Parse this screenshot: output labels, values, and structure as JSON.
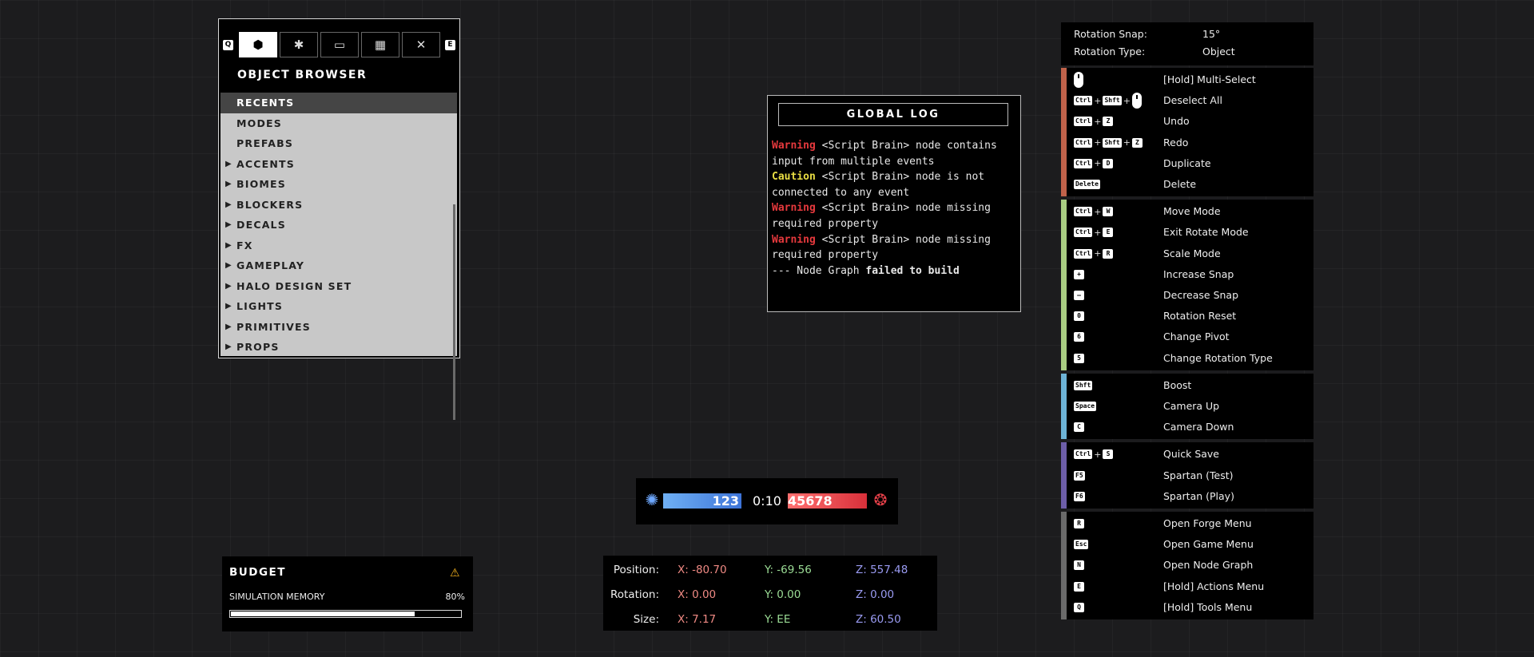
{
  "object_browser": {
    "key_left": "Q",
    "key_right": "E",
    "tabs": [
      "object-browser-icon",
      "settings-icon",
      "folder-icon",
      "map-icon",
      "tools-icon"
    ],
    "title": "OBJECT BROWSER",
    "items": [
      {
        "label": "RECENTS",
        "arrow": ""
      },
      {
        "label": "MODES",
        "arrow": ""
      },
      {
        "label": "PREFABS",
        "arrow": ""
      },
      {
        "label": "ACCENTS",
        "arrow": "▶"
      },
      {
        "label": "BIOMES",
        "arrow": "▶"
      },
      {
        "label": "BLOCKERS",
        "arrow": "▶"
      },
      {
        "label": "DECALS",
        "arrow": "▶"
      },
      {
        "label": "FX",
        "arrow": "▶"
      },
      {
        "label": "GAMEPLAY",
        "arrow": "▶"
      },
      {
        "label": "HALO DESIGN SET",
        "arrow": "▶"
      },
      {
        "label": "LIGHTS",
        "arrow": "▶"
      },
      {
        "label": "PRIMITIVES",
        "arrow": "▶"
      },
      {
        "label": "PROPS",
        "arrow": "▶"
      }
    ]
  },
  "global_log": {
    "title": "GLOBAL LOG",
    "entries": [
      {
        "level": "Warning",
        "text": "<Script Brain>  node contains input from multiple events"
      },
      {
        "level": "Caution",
        "text": "<Script Brain>  node is not connected to any event"
      },
      {
        "level": "Warning",
        "text": "<Script Brain>  node missing required property"
      },
      {
        "level": "Warning",
        "text": "<Script Brain>  node missing required property"
      }
    ],
    "footer_prefix": "--- Node Graph ",
    "footer_bold": "failed to build"
  },
  "controls": {
    "rotation_snap_label": "Rotation Snap:",
    "rotation_snap_value": "15°",
    "rotation_type_label": "Rotation Type:",
    "rotation_type_value": "Object",
    "groups": [
      {
        "color": "#c0624a",
        "rows": [
          {
            "keys": [
              "MOUSE"
            ],
            "label": "[Hold] Multi-Select"
          },
          {
            "keys": [
              "Ctrl",
              "+",
              "Shft",
              "+",
              "MOUSE"
            ],
            "label": "Deselect All"
          },
          {
            "keys": [
              "Ctrl",
              "+",
              "Z"
            ],
            "label": "Undo"
          },
          {
            "keys": [
              "Ctrl",
              "+",
              "Shft",
              "+",
              "Z"
            ],
            "label": "Redo"
          },
          {
            "keys": [
              "Ctrl",
              "+",
              "D"
            ],
            "label": "Duplicate"
          },
          {
            "keys": [
              "Delete"
            ],
            "label": "Delete"
          }
        ]
      },
      {
        "color": "#a9cd82",
        "rows": [
          {
            "keys": [
              "Ctrl",
              "+",
              "W"
            ],
            "label": "Move Mode"
          },
          {
            "keys": [
              "Ctrl",
              "+",
              "E"
            ],
            "label": "Exit Rotate Mode"
          },
          {
            "keys": [
              "Ctrl",
              "+",
              "R"
            ],
            "label": "Scale Mode"
          },
          {
            "keys": [
              "+"
            ],
            "label": "Increase Snap"
          },
          {
            "keys": [
              "–"
            ],
            "label": "Decrease Snap"
          },
          {
            "keys": [
              "0"
            ],
            "label": "Rotation Reset"
          },
          {
            "keys": [
              "6"
            ],
            "label": "Change Pivot"
          },
          {
            "keys": [
              "5"
            ],
            "label": "Change Rotation Type"
          }
        ]
      },
      {
        "color": "#6db3d6",
        "rows": [
          {
            "keys": [
              "Shft"
            ],
            "label": "Boost"
          },
          {
            "keys": [
              "Space"
            ],
            "label": "Camera Up"
          },
          {
            "keys": [
              "C"
            ],
            "label": "Camera Down"
          }
        ]
      },
      {
        "color": "#6d5ea8",
        "rows": [
          {
            "keys": [
              "Ctrl",
              "+",
              "S"
            ],
            "label": "Quick Save"
          },
          {
            "keys": [
              "F5"
            ],
            "label": "Spartan (Test)"
          },
          {
            "keys": [
              "F6"
            ],
            "label": "Spartan (Play)"
          }
        ]
      },
      {
        "color": "#6a6a6a",
        "rows": [
          {
            "keys": [
              "R"
            ],
            "label": "Open Forge Menu"
          },
          {
            "keys": [
              "Esc"
            ],
            "label": "Open Game Menu"
          },
          {
            "keys": [
              "N"
            ],
            "label": "Open Node Graph"
          },
          {
            "keys": [
              "E"
            ],
            "label": "[Hold] Actions Menu"
          },
          {
            "keys": [
              "Q"
            ],
            "label": "[Hold] Tools Menu"
          }
        ]
      }
    ]
  },
  "score": {
    "blue_score": "123",
    "time": "0:10",
    "red_score": "45678",
    "colors": {
      "blue": "#4a86e0",
      "red": "#e23b44"
    }
  },
  "budget": {
    "title": "BUDGET",
    "label": "SIMULATION MEMORY",
    "percent_text": "80%",
    "fill_fraction": 0.8
  },
  "transform": {
    "rows": [
      {
        "label": "Position:",
        "x": "X: -80.70",
        "y": "Y: -69.56",
        "z": "Z: 557.48"
      },
      {
        "label": "Rotation:",
        "x": "X: 0.00",
        "y": "Y: 0.00",
        "z": "Z: 0.00"
      },
      {
        "label": "Size:",
        "x": "X: 7.17",
        "y": "Y: EE",
        "z": "Z: 60.50"
      }
    ]
  }
}
